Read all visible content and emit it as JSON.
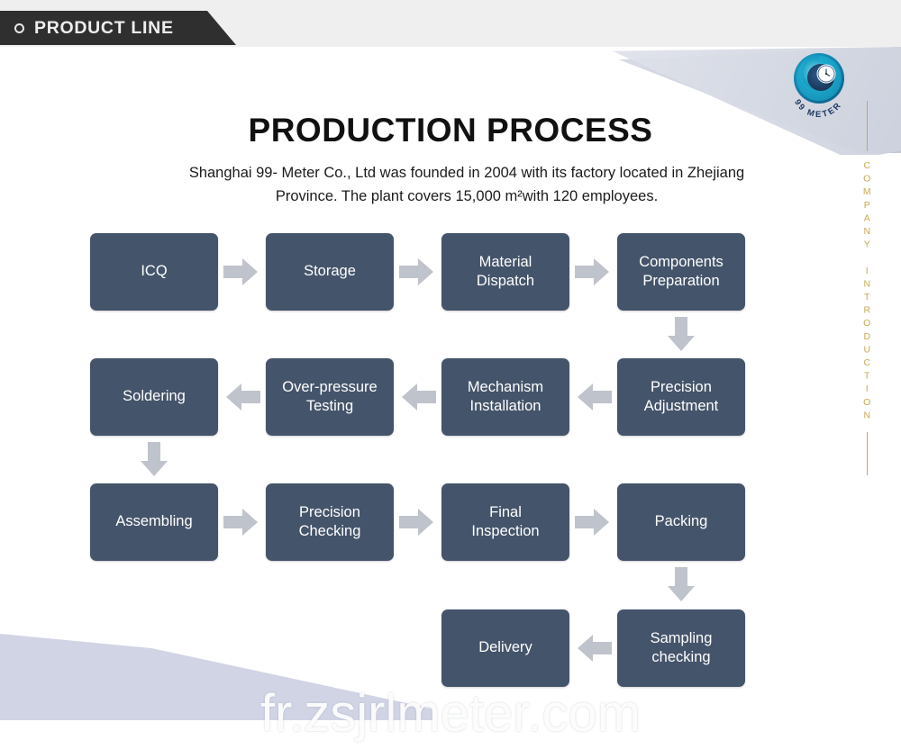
{
  "header": {
    "banner_label": "PRODUCT LINE",
    "bullet_icon": "circle-outline-icon"
  },
  "logo": {
    "brand_text": "99 METER",
    "icon": "spiral-gauge-logo-icon",
    "colors": {
      "outer": "#0f8fb5",
      "mid": "#1d9fc4",
      "inner": "#2a4d7a",
      "text": "#1f3a63"
    }
  },
  "side_rail": {
    "vertical_label": "COMPANY INTRODUCTION",
    "accent_color": "#c8a951"
  },
  "main": {
    "title": "PRODUCTION PROCESS",
    "description_line_1": "Shanghai 99- Meter Co., Ltd was founded in 2004 with its factory located in Zhejiang",
    "description_line_2": "Province. The plant covers 15,000 m²with 120 employees."
  },
  "flow": {
    "node_color": "#44546a",
    "arrow_color": "#bfc3cb",
    "nodes": [
      {
        "id": "icq",
        "label": "ICQ",
        "row": 1
      },
      {
        "id": "storage",
        "label": "Storage",
        "row": 1
      },
      {
        "id": "material-dispatch",
        "label": "Material\nDispatch",
        "row": 1
      },
      {
        "id": "components-preparation",
        "label": "Components\nPreparation",
        "row": 1
      },
      {
        "id": "soldering",
        "label": "Soldering",
        "row": 2
      },
      {
        "id": "over-pressure-testing",
        "label": "Over-pressure\nTesting",
        "row": 2
      },
      {
        "id": "mechanism-installation",
        "label": "Mechanism\nInstallation",
        "row": 2
      },
      {
        "id": "precision-adjustment",
        "label": "Precision\nAdjustment",
        "row": 2
      },
      {
        "id": "assembling",
        "label": "Assembling",
        "row": 3
      },
      {
        "id": "precision-checking",
        "label": "Precision\nChecking",
        "row": 3
      },
      {
        "id": "final-inspection",
        "label": "Final\nInspection",
        "row": 3
      },
      {
        "id": "packing",
        "label": "Packing",
        "row": 3
      },
      {
        "id": "delivery",
        "label": "Delivery",
        "row": 4
      },
      {
        "id": "sampling-checking",
        "label": "Sampling\nchecking",
        "row": 4
      }
    ],
    "arrows": [
      {
        "id": "icq-to-storage",
        "direction": "right"
      },
      {
        "id": "storage-to-material-dispatch",
        "direction": "right"
      },
      {
        "id": "material-dispatch-to-components",
        "direction": "right"
      },
      {
        "id": "components-to-precision-adjustment",
        "direction": "down"
      },
      {
        "id": "precision-adjustment-to-mechanism",
        "direction": "left"
      },
      {
        "id": "mechanism-to-over-pressure",
        "direction": "left"
      },
      {
        "id": "over-pressure-to-soldering",
        "direction": "left"
      },
      {
        "id": "soldering-to-assembling",
        "direction": "down"
      },
      {
        "id": "assembling-to-precision-checking",
        "direction": "right"
      },
      {
        "id": "precision-checking-to-final-inspection",
        "direction": "right"
      },
      {
        "id": "final-inspection-to-packing",
        "direction": "right"
      },
      {
        "id": "packing-to-sampling-checking",
        "direction": "down"
      },
      {
        "id": "sampling-checking-to-delivery",
        "direction": "left"
      }
    ]
  },
  "watermark": {
    "text": "fr.zsjrlmeter.com"
  }
}
